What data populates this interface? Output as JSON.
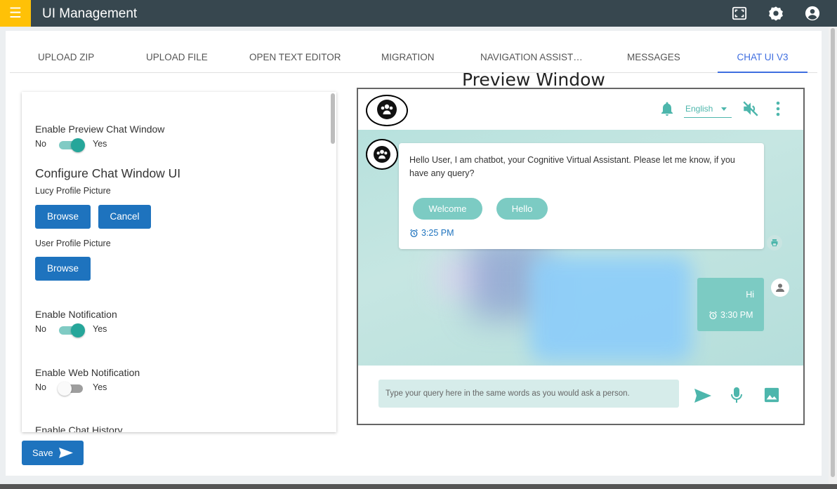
{
  "app": {
    "title": "UI Management",
    "accent_color": "#ffc107",
    "topbar_color": "#37474f",
    "icons": [
      "menu-icon",
      "fullscreen-icon",
      "settings-icon",
      "account-circle-icon"
    ]
  },
  "tabs": [
    {
      "label": "UPLOAD ZIP",
      "active": false
    },
    {
      "label": "UPLOAD FILE",
      "active": false
    },
    {
      "label": "OPEN TEXT EDITOR",
      "active": false
    },
    {
      "label": "MIGRATION",
      "active": false
    },
    {
      "label": "NAVIGATION ASSIST…",
      "active": false
    },
    {
      "label": "MESSAGES",
      "active": false
    },
    {
      "label": "CHAT UI V3",
      "active": true
    }
  ],
  "settings": {
    "preview_toggle": {
      "label": "Enable Preview Chat Window",
      "no": "No",
      "yes": "Yes",
      "on": true
    },
    "configure_heading": "Configure Chat Window UI",
    "lucy_profile_label": "Lucy Profile Picture",
    "browse_label": "Browse",
    "cancel_label": "Cancel",
    "user_profile_label": "User Profile Picture",
    "notification_toggle": {
      "label": "Enable Notification",
      "no": "No",
      "yes": "Yes",
      "on": true
    },
    "web_notification_toggle": {
      "label": "Enable Web Notification",
      "no": "No",
      "yes": "Yes",
      "on": false
    },
    "chat_history_label": "Enable Chat History"
  },
  "save_label": "Save",
  "preview": {
    "title": "Preview Window",
    "language": "English",
    "bot_message": "Hello User, I am chatbot, your Cognitive Virtual Assistant. Please let me know, if you have any query?",
    "chips": [
      "Welcome",
      "Hello"
    ],
    "bot_time": "3:25 PM",
    "user_message": "Hi",
    "user_time": "3:30 PM",
    "input_placeholder": "Type your query here in the same words as you would ask a person.",
    "header_icons": [
      "bell-icon",
      "mute-icon",
      "more-vert-icon"
    ],
    "footer_icons": [
      "send-icon",
      "mic-icon",
      "image-icon"
    ],
    "theme_color": "#4db6ac"
  }
}
